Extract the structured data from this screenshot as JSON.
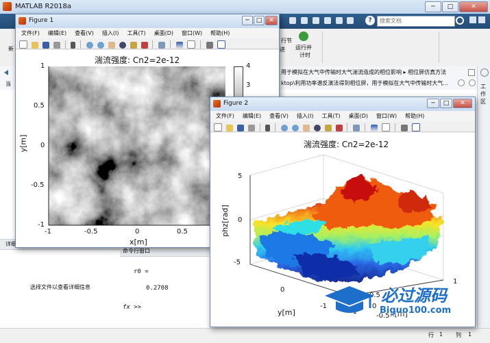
{
  "main_window": {
    "title": "MATLAB R2018a",
    "minimize": "─",
    "maximize": "□",
    "close": "✕",
    "search_placeholder": "搜索文档",
    "help_glyph": "?",
    "ribbon_run_section": "行节",
    "ribbon_run_time": "运行并\n计时",
    "ribbon_run_time_l1": "运行并",
    "ribbon_run_time_l2": "计时",
    "ribbon_new_partial": "新",
    "ribbon_run_partial": "进",
    "address_path": "用于模拟在大气中传输时大气湍流造成的相位影响 ▸ 相位屏仿真方法",
    "tab_path": "ktop\\利用功率谱反演法得到相位屏，用于模拟在大气中传输时大气...",
    "current_folder_partial": "当",
    "side_panel": "工作区",
    "details_header": "详细信息",
    "details_text": "选择文件以查看详细信息",
    "command_window_title": "命令行窗口",
    "cmd_var": "r0 =",
    "cmd_value": "0.2708",
    "cmd_prompt": "fx >>",
    "status_row_label": "行",
    "status_row": "1",
    "status_col_label": "列",
    "status_col": "1"
  },
  "figure1": {
    "title": "Figure 1",
    "menu": [
      "文件(F)",
      "编辑(E)",
      "查看(V)",
      "插入(I)",
      "工具(T)",
      "桌面(D)",
      "窗口(W)",
      "帮助(H)"
    ],
    "plot_title": "湍流强度:  Cn2=2e-12",
    "xlabel": "x[m]",
    "ylabel": "y[m]",
    "xticks": [
      "-1",
      "-0.5",
      "0",
      "0.5"
    ],
    "yticks": [
      "1",
      "0.5",
      "0",
      "-0.5",
      "-1"
    ],
    "colorbar_ticks": [
      "4",
      "3"
    ]
  },
  "figure2": {
    "title": "Figure 2",
    "menu": [
      "文件(F)",
      "编辑(E)",
      "查看(V)",
      "插入(I)",
      "工具(T)",
      "桌面(D)",
      "窗口(W)",
      "帮助(H)"
    ],
    "plot_title": "湍流强度:  Cn2=2e-12",
    "zlabel": "phz[rad]",
    "xlabel": "x[m]",
    "ylabel": "y[m]",
    "zticks": [
      "5",
      "0",
      "-5"
    ],
    "yticks": [
      "0",
      "-1"
    ],
    "xticks": [
      "1",
      "0.5",
      "0",
      "-0.5",
      "-1"
    ]
  },
  "watermark": {
    "brand": "必过源码",
    "url": "Biguo100.com"
  },
  "colors": {
    "matlab_blue": "#244c76",
    "window_border": "#6e8bb0",
    "watermark_blue": "#1e6fc9"
  }
}
